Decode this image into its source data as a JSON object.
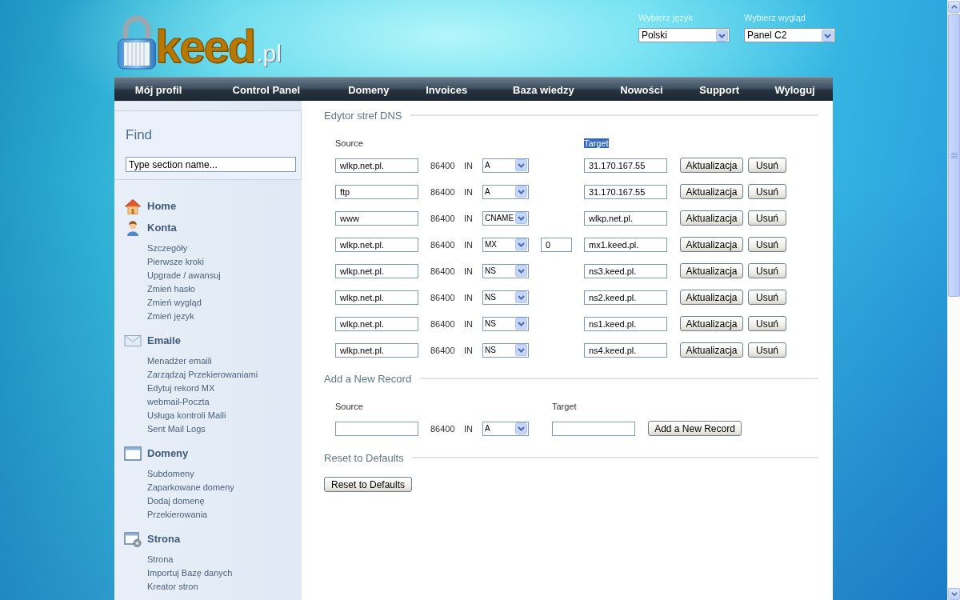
{
  "header": {
    "logo": {
      "name": "keed",
      "suffix": ".pl"
    },
    "selectors": [
      {
        "label": "Wybierz język",
        "value": "Polski"
      },
      {
        "label": "Wybierz wygląd",
        "value": "Panel C2"
      }
    ]
  },
  "nav": [
    "Mój profil",
    "Control Panel",
    "Domeny",
    "Invoices",
    "Baza wiedzy",
    "Nowości",
    "Support",
    "Wyloguj"
  ],
  "sidebar": {
    "find": {
      "title": "Find",
      "value": "Type section name..."
    },
    "sections": [
      {
        "title": "Home"
      },
      {
        "title": "Konta",
        "items": [
          "Szczegóły",
          "Pierwsze kroki",
          "Upgrade / awansuj",
          "Zmień hasło",
          "Zmień wygląd",
          "Zmień język"
        ]
      },
      {
        "title": "Emaile",
        "items": [
          "Menadżer emaili",
          "Zarządzaj Przekierowaniami",
          "Edytuj rekord MX",
          "webmail-Poczta",
          "Usługa kontroli Maili",
          "Sent Mail Logs"
        ]
      },
      {
        "title": "Domeny",
        "items": [
          "Subdomeny",
          "Zaparkowane domeny",
          "Dodaj domenę",
          "Przekierowania"
        ]
      },
      {
        "title": "Strona",
        "items": [
          "Strona",
          "Importuj Bazę danych",
          "Kreator stron"
        ]
      }
    ]
  },
  "dns_editor": {
    "legend": "Edytor stref DNS",
    "columns": [
      {
        "label": "Source",
        "highlighted": false
      },
      {
        "label": "Target",
        "highlighted": true
      }
    ],
    "records": [
      {
        "source": "wlkp.net.pl.",
        "ttl": "86400",
        "class": "IN",
        "type": "A",
        "target": "31.170.167.55",
        "buttons": [
          "Aktualizacja",
          "Usuń"
        ]
      },
      {
        "source": "ftp",
        "ttl": "86400",
        "class": "IN",
        "type": "A",
        "target": "31.170.167.55",
        "buttons": [
          "Aktualizacja",
          "Usuń"
        ]
      },
      {
        "source": "www",
        "ttl": "86400",
        "class": "IN",
        "type": "CNAME",
        "target": "wlkp.net.pl.",
        "buttons": [
          "Aktualizacja",
          "Usuń"
        ]
      },
      {
        "source": "wlkp.net.pl.",
        "ttl": "86400",
        "class": "IN",
        "type": "MX",
        "priority": "0",
        "target": "mx1.keed.pl.",
        "buttons": [
          "Aktualizacja",
          "Usuń"
        ]
      },
      {
        "source": "wlkp.net.pl.",
        "ttl": "86400",
        "class": "IN",
        "type": "NS",
        "target": "ns3.keed.pl.",
        "buttons": [
          "Aktualizacja",
          "Usuń"
        ]
      },
      {
        "source": "wlkp.net.pl.",
        "ttl": "86400",
        "class": "IN",
        "type": "NS",
        "target": "ns2.keed.pl.",
        "buttons": [
          "Aktualizacja",
          "Usuń"
        ]
      },
      {
        "source": "wlkp.net.pl.",
        "ttl": "86400",
        "class": "IN",
        "type": "NS",
        "target": "ns1.keed.pl.",
        "buttons": [
          "Aktualizacja",
          "Usuń"
        ]
      },
      {
        "source": "wlkp.net.pl.",
        "ttl": "86400",
        "class": "IN",
        "type": "NS",
        "target": "ns4.keed.pl.",
        "buttons": [
          "Aktualizacja",
          "Usuń"
        ]
      }
    ]
  },
  "add_record": {
    "legend": "Add a New Record",
    "columns": [
      {
        "label": "Source",
        "highlighted": false
      },
      {
        "label": "Target",
        "highlighted": false
      }
    ],
    "ttl": "86400",
    "class": "IN",
    "type": "A",
    "button": "Add a New Record"
  },
  "reset": {
    "legend": "Reset to Defaults",
    "button": "Reset to Defaults"
  }
}
